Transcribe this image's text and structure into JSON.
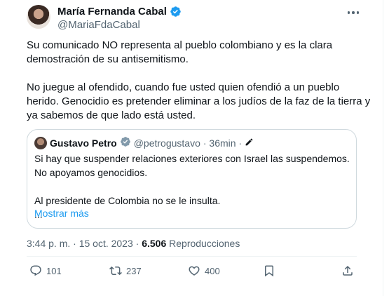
{
  "tweet": {
    "author_name": "María Fernanda Cabal",
    "author_handle": "@MariaFdaCabal",
    "paragraphs": [
      "Su comunicado NO representa al pueblo colombiano y es la clara demostración de su antisemitismo.",
      "No juegue al ofendido, cuando fue usted quien ofendió a un pueblo herido. Genocidio es pretender eliminar a los judíos de la faz de la tierra y ya sabemos de que lado está usted."
    ],
    "quoted": {
      "author_name": "Gustavo Petro",
      "author_handle": "@petrogustavo",
      "time": "· 36min ·",
      "lines": [
        "Si hay que suspender relaciones exteriores con Israel las suspendemos. No apoyamos genocidios.",
        "",
        "Al presidente de Colombia no se le insulta.",
        "..."
      ],
      "show_more": "Mostrar más"
    },
    "time_date": "3:44 p. m. · 15 oct. 2023 ·",
    "views": "6.506",
    "views_label": "Reproducciones",
    "actions": {
      "replies": "101",
      "retweets": "237",
      "likes": "400"
    }
  },
  "colors": {
    "text": "#0f1419",
    "secondary": "#536471",
    "verified": "#1d9bf0",
    "link": "#1d9bf0",
    "border": "#cfd9de"
  },
  "icons": [
    "verified-badge-icon",
    "more-options-icon",
    "edited-pencil-icon",
    "reply-icon",
    "retweet-icon",
    "like-icon",
    "bookmark-icon",
    "share-icon"
  ]
}
